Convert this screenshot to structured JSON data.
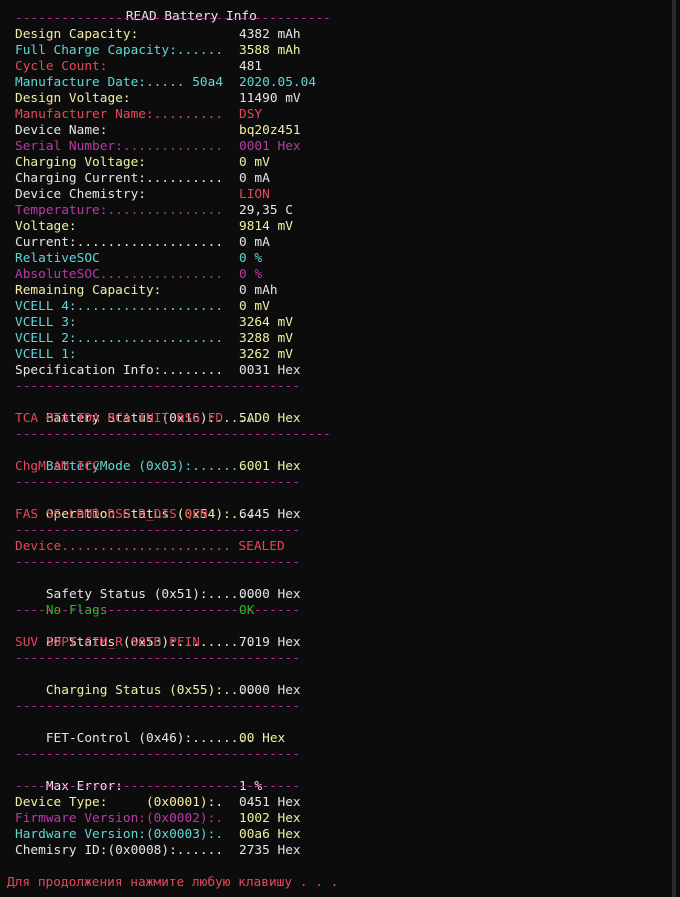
{
  "title": "READ Battery Info",
  "separator_long": "-----------------------------------------",
  "separator_mid": "--------------------------------------",
  "rows": [
    {
      "label": "Design Capacity:",
      "value": "4382 mAh",
      "label_color": "#f2f0a6",
      "value_color": "#e6e6e6"
    },
    {
      "label": "Full Charge Capacity:......",
      "value": "3588 mAh",
      "label_color": "#61d6d6",
      "value_color": "#f2f0a6"
    },
    {
      "label": "Cycle Count:",
      "value": "481",
      "label_color": "#e74856",
      "value_color": "#e6e6e6"
    },
    {
      "label": "Manufacture Date:..... 50a4",
      "value": "2020.05.04",
      "label_color": "#61d6d6",
      "value_color": "#61d6d6"
    },
    {
      "label": "Design Voltage:",
      "value": "11490 mV",
      "label_color": "#f2f0a6",
      "value_color": "#e6e6e6"
    },
    {
      "label": "Manufacturer Name:.........",
      "value": "DSY",
      "label_color": "#e74856",
      "value_color": "#e74856"
    },
    {
      "label": "Device Name:",
      "value": "bq20z451",
      "label_color": "#e6e6e6",
      "value_color": "#f2f0a6"
    },
    {
      "label": "Serial Number:.............",
      "value": "0001 Hex",
      "label_color": "#b93aa7",
      "value_color": "#b93aa7"
    },
    {
      "label": "Charging Voltage:",
      "value": "0 mV",
      "label_color": "#f2f0a6",
      "value_color": "#f2f0a6"
    },
    {
      "label": "Charging Current:..........",
      "value": "0 mA",
      "label_color": "#e6e6e6",
      "value_color": "#e6e6e6"
    },
    {
      "label": "Device Chemistry:",
      "value": "LION",
      "label_color": "#e6e6e6",
      "value_color": "#e74856"
    },
    {
      "label": "Temperature:...............",
      "value": "29,35 C",
      "label_color": "#b93aa7",
      "value_color": "#e6e6e6"
    },
    {
      "label": "Voltage:",
      "value": "9814 mV",
      "label_color": "#f2f0a6",
      "value_color": "#f2f0a6"
    },
    {
      "label": "Current:...................",
      "value": "0 mA",
      "label_color": "#e6e6e6",
      "value_color": "#e6e6e6"
    },
    {
      "label": "RelativeSOC",
      "value": "0 %",
      "label_color": "#61d6d6",
      "value_color": "#61d6d6"
    },
    {
      "label": "AbsoluteSOC................",
      "value": "0 %",
      "label_color": "#b93aa7",
      "value_color": "#b93aa7"
    },
    {
      "label": "Remaining Capacity:",
      "value": "0 mAh",
      "label_color": "#f2f0a6",
      "value_color": "#e6e6e6"
    },
    {
      "label": "VCELL 4:...................",
      "value": "0 mV",
      "label_color": "#61d6d6",
      "value_color": "#f2f0a6"
    },
    {
      "label": "VCELL 3:",
      "value": "3264 mV",
      "label_color": "#61d6d6",
      "value_color": "#f2f0a6"
    },
    {
      "label": "VCELL 2:...................",
      "value": "3288 mV",
      "label_color": "#61d6d6",
      "value_color": "#f2f0a6"
    },
    {
      "label": "VCELL 1:",
      "value": "3262 mV",
      "label_color": "#61d6d6",
      "value_color": "#f2f0a6"
    },
    {
      "label": "Specification Info:........",
      "value": "0031 Hex",
      "label_color": "#e6e6e6",
      "value_color": "#e6e6e6"
    }
  ],
  "sections": {
    "battery_status": {
      "label": "Battery Status (0x16):.....",
      "value": "5AD0 Hex",
      "flags": "TCA OTA TDA RCA INIT DSG FD"
    },
    "battery_mode": {
      "label": "BatteryMode (0x03):........",
      "value": "6001 Hex",
      "flags": "ChgM AM ICC"
    },
    "operation_status": {
      "label": "Operation Status (0x54):...",
      "value": "6445 Hex",
      "flags": "FAS SS LDMD DSG R_DIS QEN"
    },
    "device": {
      "text": "Device...................... SEALED"
    },
    "safety_status": {
      "label": "Safety Status (0x51):......",
      "value": "0000 Hex",
      "flags_label": "No Flags",
      "flags_value": "OK"
    },
    "pf_status": {
      "label": "PF Status (0x53):..........",
      "value": "7019 Hex",
      "flags": "SUV SOPT CIM_R SOTD PFIN"
    },
    "charging_status": {
      "label": "Charging Status (0x55):....",
      "value": "0000 Hex"
    },
    "fet_control": {
      "label": "FET-Control (0x46):........",
      "value": "00 Hex"
    },
    "max_error": {
      "label": "Max Error:",
      "value": "1 %"
    }
  },
  "versions": [
    {
      "label": "Device Type:     (0x0001):.",
      "value": "0451 Hex",
      "label_color": "#f2f0a6",
      "value_color": "#e6e6e6"
    },
    {
      "label": "Firmware Version:(0x0002):.",
      "value": "1002 Hex",
      "label_color": "#b93aa7",
      "value_color": "#f2f0a6"
    },
    {
      "label": "Hardware Version:(0x0003):.",
      "value": "00a6 Hex",
      "label_color": "#61d6d6",
      "value_color": "#f2f0a6"
    },
    {
      "label": "Chemisry ID:(0x0008):......",
      "value": "2735 Hex",
      "label_color": "#e6e6e6",
      "value_color": "#e6e6e6"
    }
  ],
  "prompt": "Для продолжения нажмите любую клавишу . . ."
}
